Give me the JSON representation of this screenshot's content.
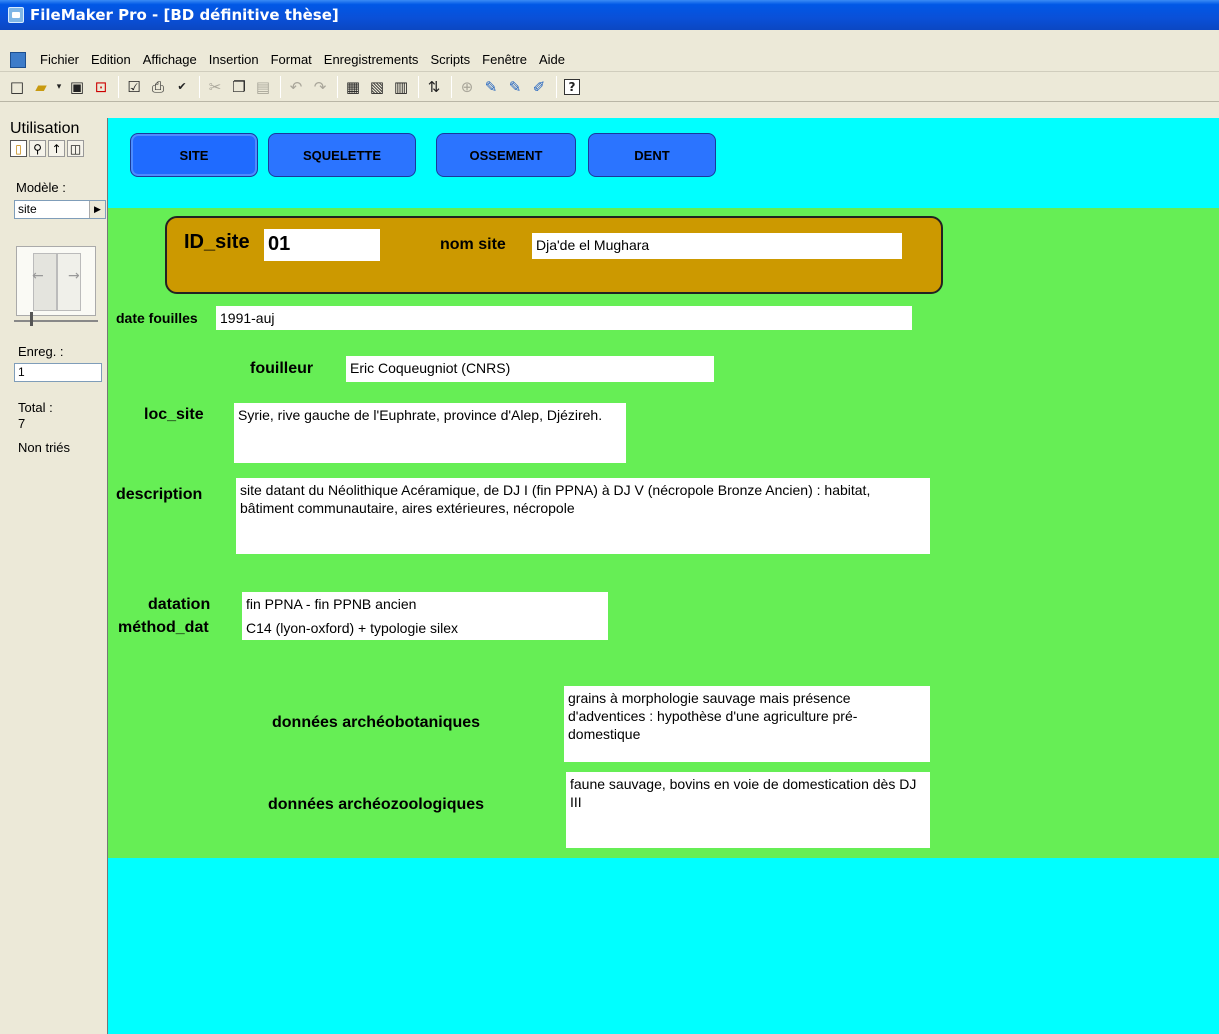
{
  "window": {
    "title": "FileMaker Pro - [BD définitive thèse]"
  },
  "menu": [
    "Fichier",
    "Edition",
    "Affichage",
    "Insertion",
    "Format",
    "Enregistrements",
    "Scripts",
    "Fenêtre",
    "Aide"
  ],
  "toolbar": {
    "icons": [
      "new-file-icon",
      "open-file-icon",
      "save-icon",
      "pdf-icon",
      "checkbox-icon",
      "print-icon",
      "spellcheck-icon",
      "cut-icon",
      "copy-icon",
      "paste-icon",
      "undo-icon",
      "redo-icon",
      "record-icon",
      "new-record-icon",
      "delete-record-icon",
      "sort-icon",
      "lock-icon",
      "script-icon",
      "script-2-icon",
      "script-3-icon",
      "help-icon"
    ],
    "help_label": "?"
  },
  "status": {
    "mode_label": "Utilisation",
    "layout_label": "Modèle :",
    "layout_value": "site",
    "record_label": "Enreg. :",
    "record_value": "1",
    "total_label": "Total :",
    "total_value": "7",
    "sort_status": "Non triés"
  },
  "nav": {
    "site": "SITE",
    "squelette": "SQUELETTE",
    "ossement": "OSSEMENT",
    "dent": "DENT"
  },
  "record": {
    "id_site_label": "ID_site",
    "id_site_value": "01",
    "nom_site_label": "nom site",
    "nom_site_value": "Dja'de el Mughara",
    "date_fouilles_label": "date fouilles",
    "date_fouilles_value": "1991-auj",
    "fouilleur_label": "fouilleur",
    "fouilleur_value": "Eric Coqueugniot (CNRS)",
    "loc_site_label": "loc_site",
    "loc_site_value": "Syrie, rive gauche de l'Euphrate, province d'Alep, Djézireh.",
    "description_label": "description",
    "description_value": "site datant du Néolithique Acéramique, de DJ I (fin PPNA) à DJ V (nécropole Bronze Ancien) : habitat, bâtiment communautaire, aires extérieures, nécropole",
    "datation_label": "datation",
    "datation_value": "fin PPNA - fin PPNB ancien",
    "methode_label": "méthod_dat",
    "methode_value": "C14 (lyon-oxford) + typologie silex",
    "archeobotanique_label": "données archéobotaniques",
    "archeobotanique_value": "grains à morphologie sauvage mais présence d'adventices : hypothèse d'une agriculture pré-domestique",
    "archeozoologique_label": "données archéozoologiques",
    "archeozoologique_value": "faune sauvage, bovins en voie de domestication dès DJ III"
  },
  "colors": {
    "header_band": "#00ffff",
    "body_band": "#66ee55",
    "id_panel": "#cc9900",
    "nav_button": "#2b74ff"
  }
}
